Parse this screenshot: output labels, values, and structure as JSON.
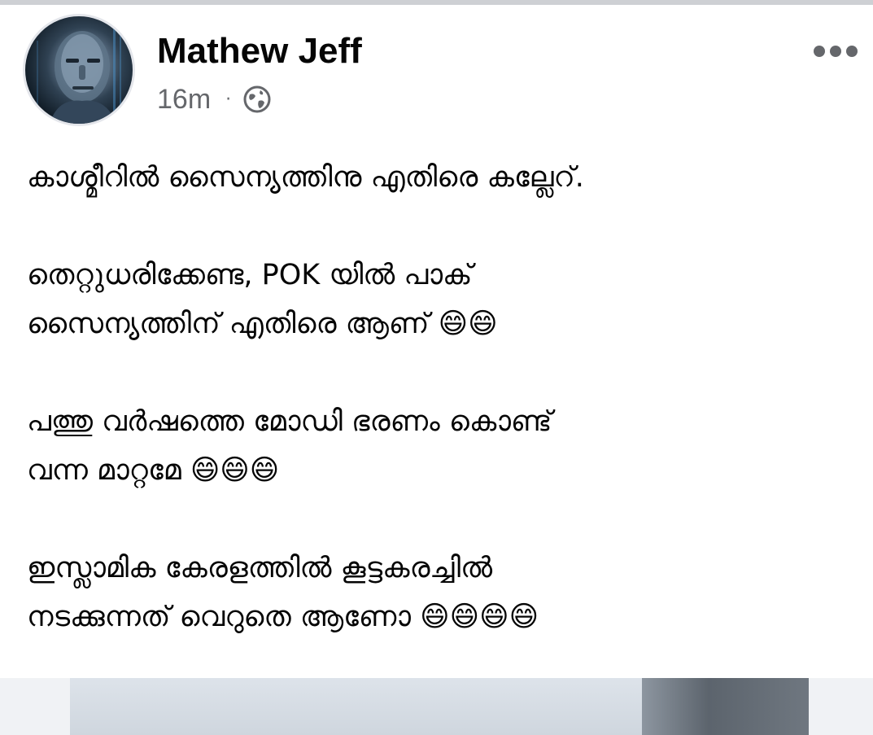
{
  "post": {
    "author": "Mathew Jeff",
    "timestamp": "16m",
    "separator": "·",
    "privacy_icon": "globe-icon",
    "more_icon": "more-horizontal-icon",
    "paragraphs": [
      [
        "കാശ്മീറിൽ സൈന്യത്തിനു എതിരെ കല്ലേറ്."
      ],
      [
        "തെറ്റുധരിക്കേണ്ട, POK യിൽ പാക്",
        "സൈന്യത്തിന് എതിരെ ആണ് 😄😄"
      ],
      [
        "പത്തു വർഷത്തെ മോഡി ഭരണം കൊണ്ട്",
        "വന്ന മാറ്റമേ 😄😄😄"
      ],
      [
        "ഇസ്ലാമിക കേരളത്തിൽ കൂട്ടകരച്ചിൽ",
        "നടക്കുന്നത് വെറുതെ ആണോ 😄😄😄😄"
      ]
    ]
  },
  "colors": {
    "primary_text": "#050505",
    "secondary_text": "#65676b",
    "divider": "#ced0d4",
    "media_background": "#f0f2f5"
  }
}
